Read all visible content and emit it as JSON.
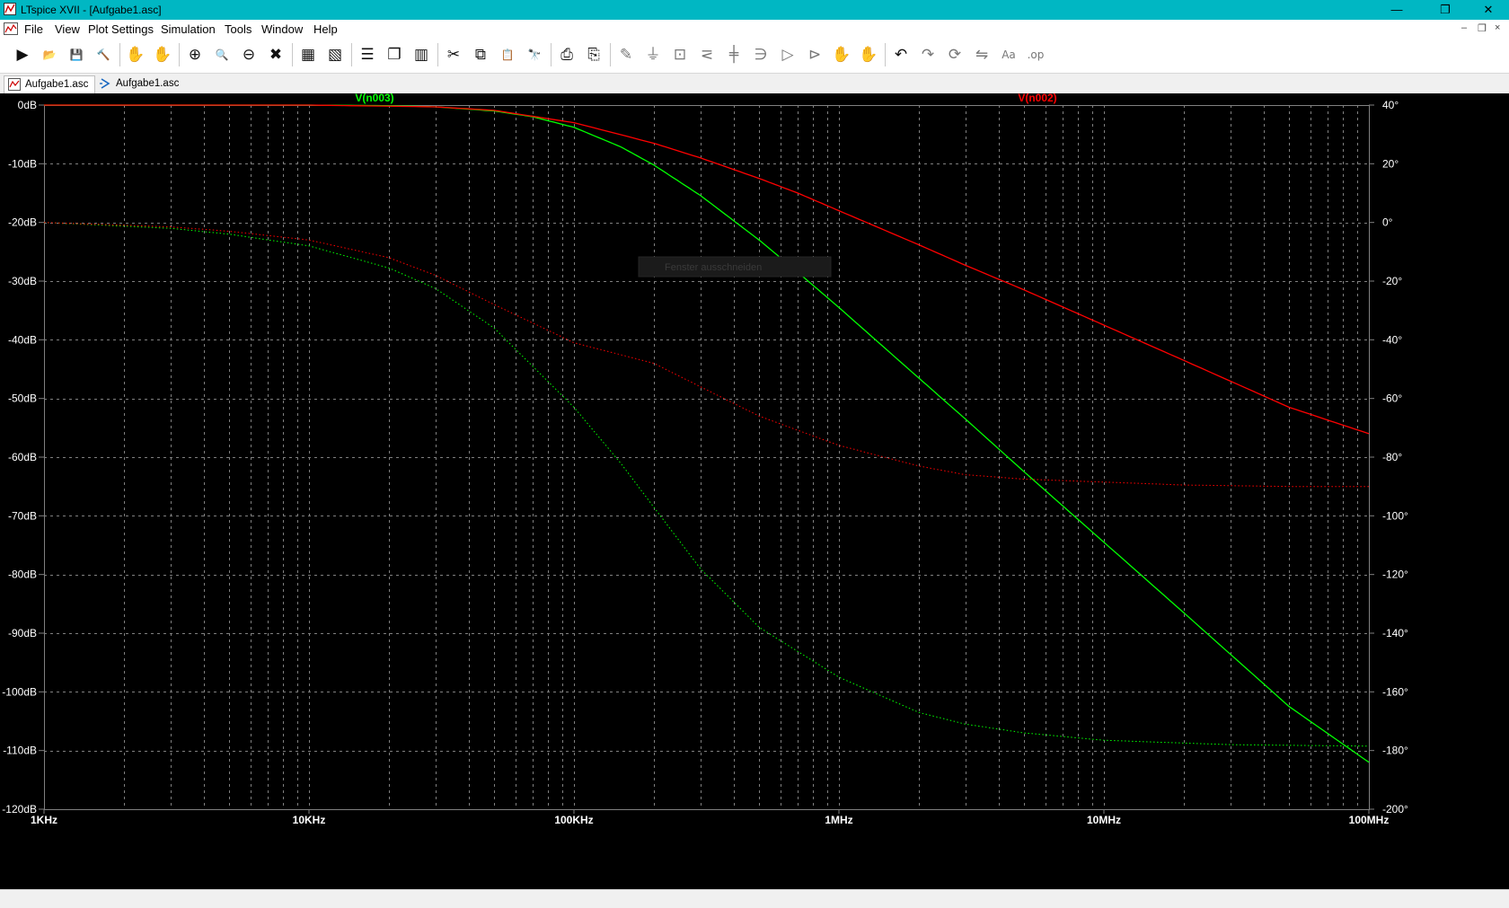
{
  "window": {
    "title": "LTspice XVII - [Aufgabe1.asc]",
    "minimize_glyph": "—",
    "restore_glyph": "❐",
    "close_glyph": "✕"
  },
  "menu": {
    "items": [
      "File",
      "View",
      "Plot Settings",
      "Simulation",
      "Tools",
      "Window",
      "Help"
    ],
    "mdi_controls": [
      "–",
      "❐",
      "×"
    ]
  },
  "toolbar": {
    "buttons": [
      "run-icon",
      "open-icon",
      "save-icon",
      "control-panel-icon",
      "halt-icon",
      "pan-icon",
      "zoom-in-icon",
      "zoom-area-icon",
      "zoom-out-icon",
      "zoom-fit-icon",
      "autorange-icon",
      "mark-unconnected-icon",
      "tile-horizontal-icon",
      "cascade-icon",
      "tile-vertical-icon",
      "cut-icon",
      "copy-icon",
      "paste-icon",
      "find-icon",
      "print-icon",
      "print-setup-icon",
      "wire-icon",
      "ground-icon",
      "label-net-icon",
      "resistor-icon",
      "capacitor-icon",
      "inductor-icon",
      "diode-icon",
      "component-icon",
      "move-icon",
      "drag-icon",
      "undo-icon",
      "redo-icon",
      "rotate-icon",
      "mirror-icon",
      "text-icon",
      "spice-directive-icon"
    ]
  },
  "tabs": [
    {
      "label": "Aufgabe1.asc",
      "icon": "waveform-icon",
      "active": true
    },
    {
      "label": "Aufgabe1.asc",
      "icon": "schematic-icon",
      "active": false
    }
  ],
  "floating_hint": "Fenster ausschneiden",
  "chart_data": {
    "type": "line",
    "title": "",
    "xlabel": "",
    "ylabel": "",
    "x_scale": "log",
    "xlim": [
      1000,
      100000000
    ],
    "ylim_left": [
      -120,
      0
    ],
    "ylim_right": [
      -200,
      40
    ],
    "x_tick_labels": [
      "1KHz",
      "10KHz",
      "100KHz",
      "1MHz",
      "10MHz",
      "100MHz"
    ],
    "y_tick_labels_left": [
      "0dB",
      "-10dB",
      "-20dB",
      "-30dB",
      "-40dB",
      "-50dB",
      "-60dB",
      "-70dB",
      "-80dB",
      "-90dB",
      "-100dB",
      "-110dB",
      "-120dB"
    ],
    "y_tick_labels_right": [
      "40°",
      "20°",
      "0°",
      "-20°",
      "-40°",
      "-60°",
      "-80°",
      "-100°",
      "-120°",
      "-140°",
      "-160°",
      "-180°",
      "-200°"
    ],
    "grid": true,
    "background": "#000000",
    "axis_color": "#808080",
    "series": [
      {
        "name": "V(n003)",
        "color": "#00ff00",
        "label_position": "left",
        "magnitude_db": {
          "x": [
            1000,
            10000,
            20000,
            30000,
            50000,
            70000,
            100000,
            150000,
            200000,
            300000,
            500000,
            700000,
            1000000,
            2000000,
            3000000,
            5000000,
            10000000,
            20000000,
            50000000,
            100000000
          ],
          "y": [
            0,
            0,
            -0.1,
            -0.3,
            -1.0,
            -2.0,
            -3.8,
            -7.1,
            -10.2,
            -15.4,
            -23.0,
            -28.5,
            -34.5,
            -46.5,
            -53.5,
            -62.5,
            -74.5,
            -86.5,
            -102.5,
            -112.0
          ]
        },
        "phase_deg": {
          "x": [
            1000,
            3000,
            5000,
            10000,
            20000,
            30000,
            50000,
            100000,
            150000,
            200000,
            300000,
            500000,
            1000000,
            2000000,
            3000000,
            5000000,
            10000000,
            30000000,
            100000000
          ],
          "y": [
            0,
            -2,
            -4,
            -8,
            -15.5,
            -22.5,
            -36,
            -63,
            -82,
            -97,
            -118,
            -138,
            -155,
            -167,
            -171,
            -174,
            -176.5,
            -178,
            -178.5
          ]
        }
      },
      {
        "name": "V(n002)",
        "color": "#ff0000",
        "label_position": "right",
        "magnitude_db": {
          "x": [
            1000,
            10000,
            30000,
            50000,
            100000,
            200000,
            300000,
            500000,
            700000,
            1000000,
            2000000,
            3000000,
            5000000,
            10000000,
            20000000,
            50000000,
            100000000
          ],
          "y": [
            0,
            0,
            -0.3,
            -0.9,
            -3.0,
            -6.5,
            -9.0,
            -12.5,
            -15.0,
            -18.0,
            -23.8,
            -27.3,
            -31.5,
            -37.5,
            -43.5,
            -51.5,
            -56.0
          ]
        },
        "phase_deg": {
          "x": [
            1000,
            3000,
            5000,
            10000,
            20000,
            30000,
            50000,
            100000,
            200000,
            300000,
            500000,
            1000000,
            2000000,
            3000000,
            5000000,
            10000000,
            20000000,
            50000000,
            100000000
          ],
          "y": [
            0,
            -1.5,
            -3,
            -6,
            -12,
            -18,
            -28,
            -41,
            -48,
            -56,
            -66,
            -76,
            -83,
            -86,
            -87.5,
            -88.5,
            -89.5,
            -90,
            -90
          ]
        }
      }
    ]
  }
}
